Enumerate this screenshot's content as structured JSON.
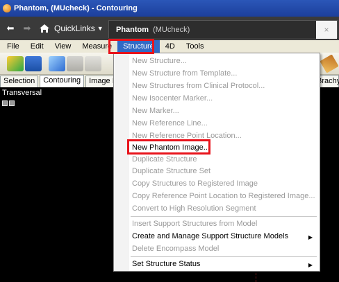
{
  "window": {
    "title": "Phantom, (MUcheck) - Contouring"
  },
  "nav": {
    "back_glyph": "⬅",
    "forward_glyph": "➡",
    "quicklinks_label": "QuickLinks",
    "caret": "▼",
    "tab_title": "Phantom",
    "tab_subtitle": "(MUcheck)",
    "close_glyph": "×"
  },
  "menubar": {
    "items": [
      "File",
      "Edit",
      "View",
      "Measure",
      "Structure",
      "4D",
      "Tools"
    ]
  },
  "workspace_tabs": [
    "Selection",
    "Contouring",
    "Image I"
  ],
  "brachy_tab": "Brachy",
  "viewer": {
    "label": "Transversal"
  },
  "structure_menu": {
    "items": [
      {
        "label": "New Structure...",
        "enabled": false
      },
      {
        "label": "New Structure from Template...",
        "enabled": false
      },
      {
        "label": "New Structures from Clinical Protocol...",
        "enabled": false
      },
      {
        "label": "New Isocenter Marker...",
        "enabled": false
      },
      {
        "label": "New Marker...",
        "enabled": false
      },
      {
        "label": "New Reference Line...",
        "enabled": false
      },
      {
        "label": "New Reference Point Location...",
        "enabled": false
      },
      {
        "label": "New Phantom Image...",
        "enabled": true
      },
      {
        "label": "Duplicate Structure",
        "enabled": false
      },
      {
        "label": "Duplicate Structure Set",
        "enabled": false
      },
      {
        "label": "Copy Structures to Registered Image",
        "enabled": false
      },
      {
        "label": "Copy Reference Point Location to Registered Image...",
        "enabled": false
      },
      {
        "label": "Convert to High Resolution Segment",
        "enabled": false
      },
      {
        "label": "Insert Support Structures from Model",
        "enabled": false
      },
      {
        "label": "Create and Manage Support Structure Models",
        "enabled": true,
        "submenu": true
      },
      {
        "label": "Delete Encompass Model",
        "enabled": false
      },
      {
        "label": "Set Structure Status",
        "enabled": true,
        "submenu": true
      }
    ],
    "submenu_glyph": "▶"
  },
  "colors": {
    "highlight_box": "#e8131b",
    "titlebar": "#2b57b8",
    "menu_open": "#316ac5"
  }
}
